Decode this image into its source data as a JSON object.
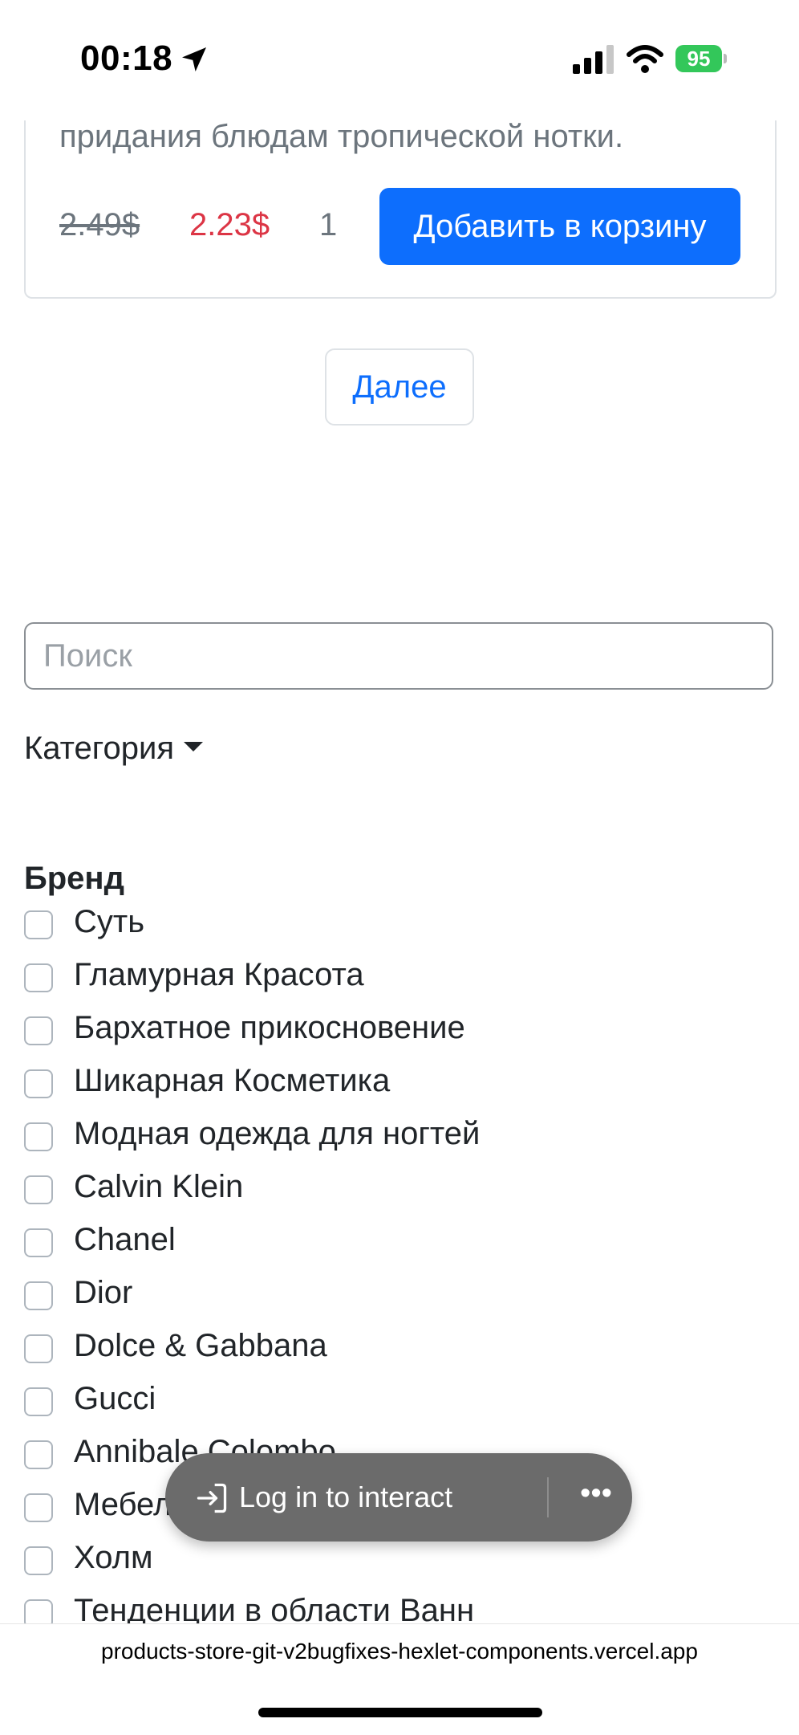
{
  "status_bar": {
    "time": "00:18",
    "battery": "95"
  },
  "product": {
    "description_partial": "придания блюдам тропической нотки.",
    "old_price": "2.49$",
    "new_price": "2.23$",
    "quantity": "1",
    "add_to_cart_label": "Добавить в корзину"
  },
  "pagination": {
    "next_label": "Далее"
  },
  "filters": {
    "search_placeholder": "Поиск",
    "category_label": "Категория",
    "brand_title": "Бренд",
    "brands": [
      "Суть",
      "Гламурная Красота",
      "Бархатное прикосновение",
      "Шикарная Косметика",
      "Модная одежда для ногтей",
      "Calvin Klein",
      "Chanel",
      "Dior",
      "Dolce & Gabbana",
      "Gucci",
      "Annibale Colombo",
      "Мебель",
      "Холм",
      "Тенденции в области Ванн"
    ]
  },
  "overlay": {
    "login_label": "Log in to interact",
    "more_icon": "ellipsis-icon"
  },
  "browser": {
    "url": "products-store-git-v2bugfixes-hexlet-components.vercel.app"
  }
}
